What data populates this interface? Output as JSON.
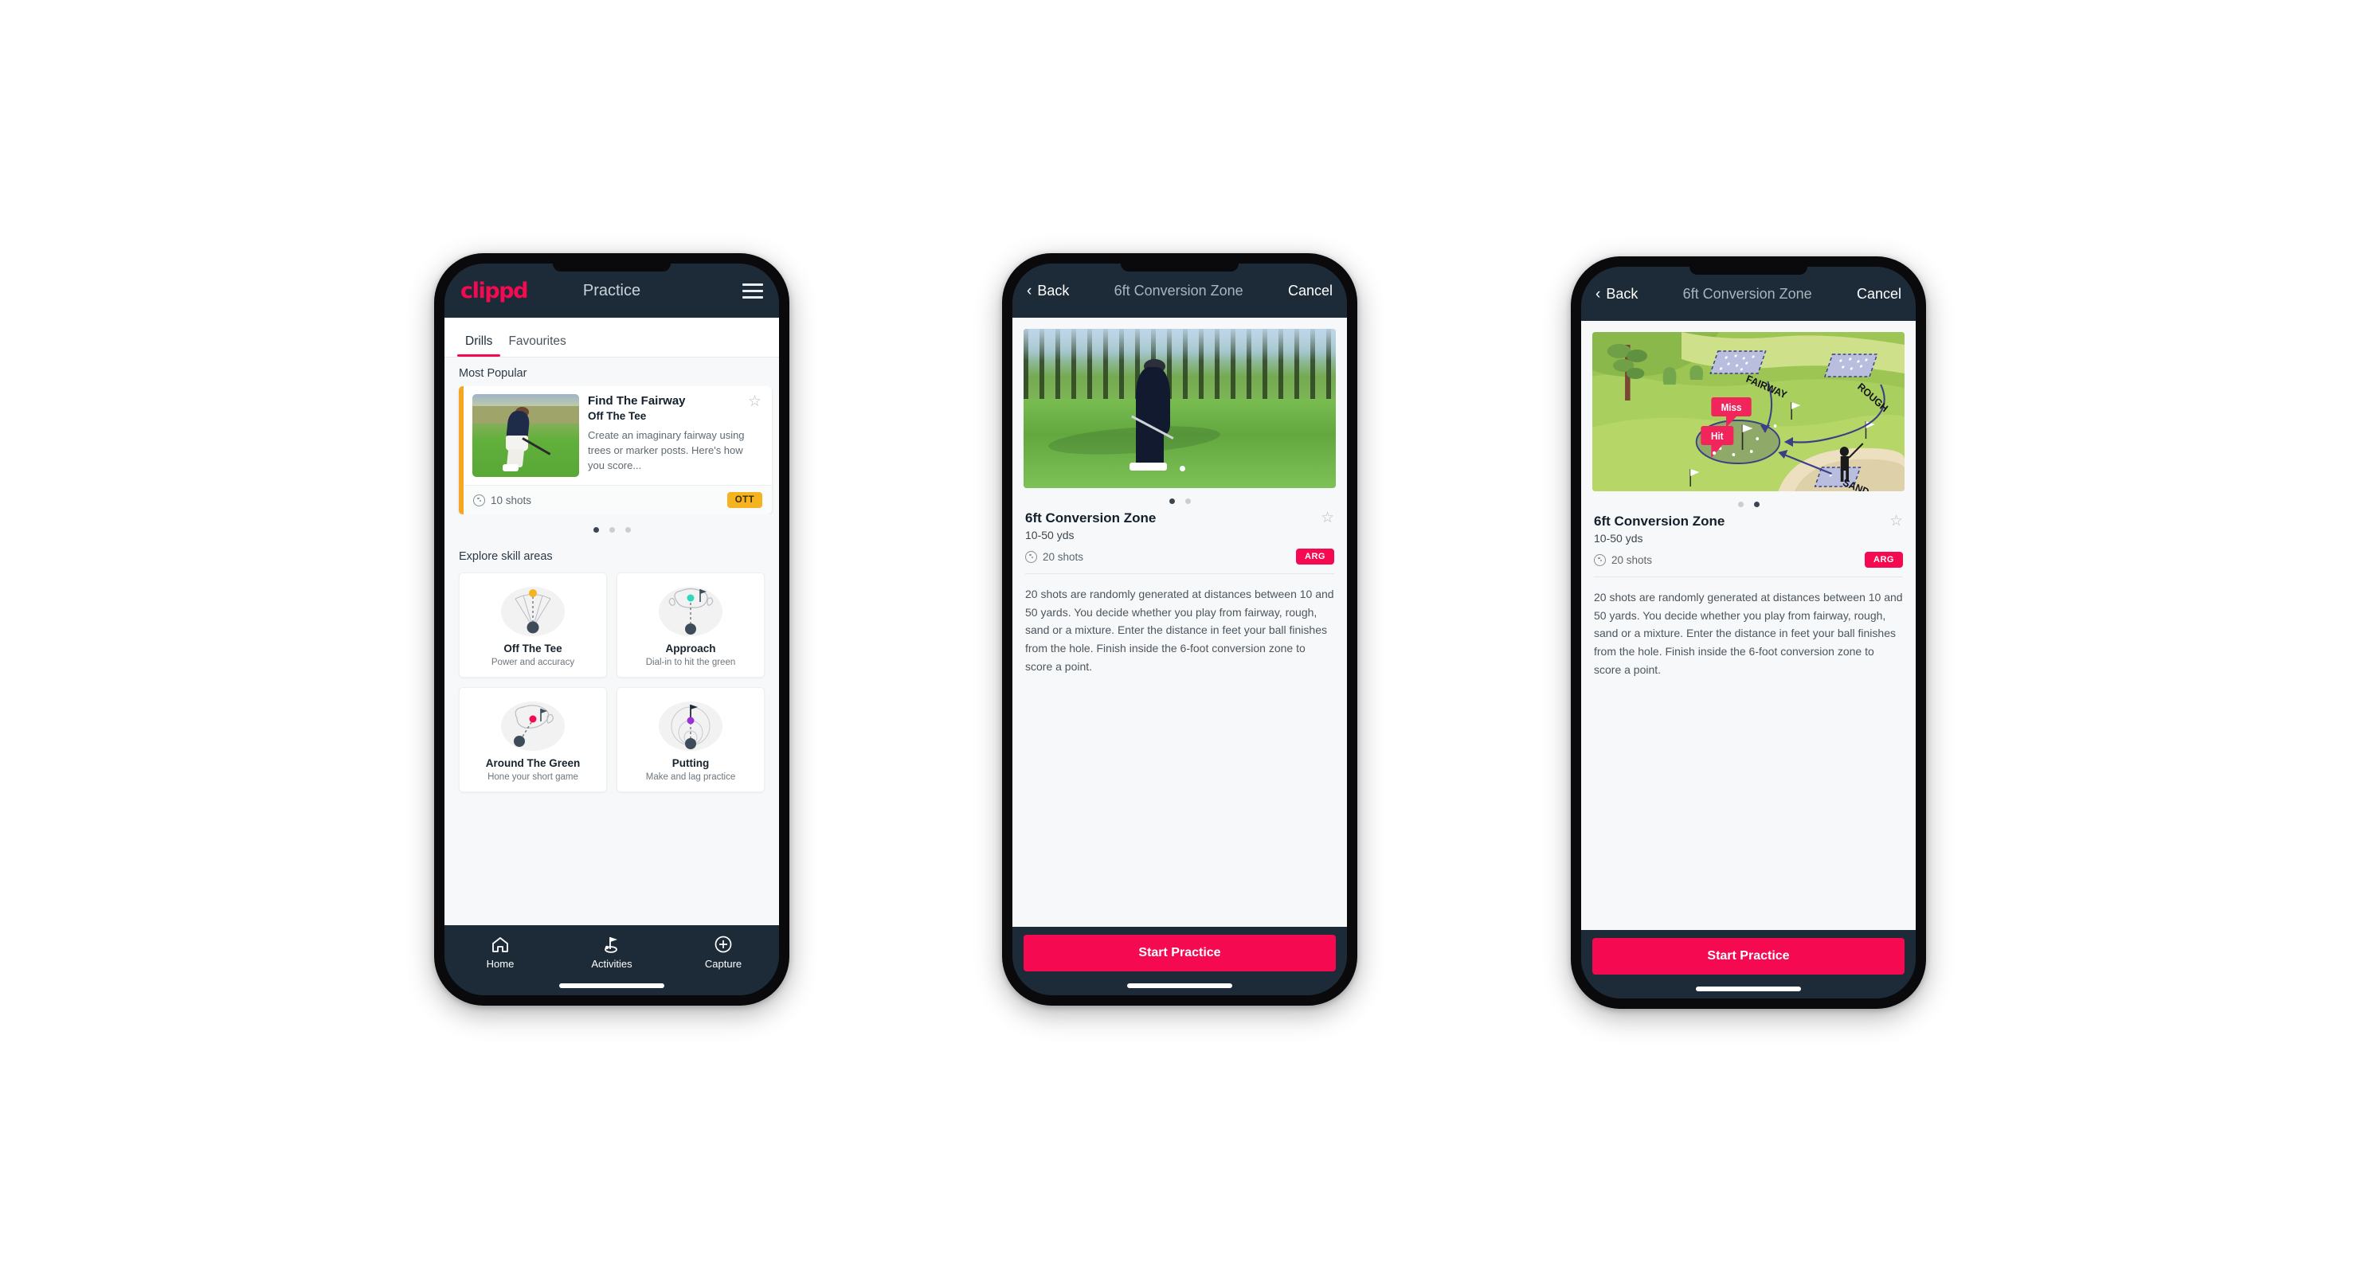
{
  "phone1": {
    "appbar": {
      "brand": "clippd",
      "title": "Practice",
      "menu_icon": "hamburger-icon"
    },
    "tabs": [
      {
        "label": "Drills",
        "active": true
      },
      {
        "label": "Favourites",
        "active": false
      }
    ],
    "most_popular": {
      "section_label": "Most Popular",
      "card": {
        "title": "Find The Fairway",
        "subtitle": "Off The Tee",
        "description": "Create an imaginary fairway using trees or marker posts. Here's how you score...",
        "shots": "10 shots",
        "badge": "OTT",
        "badge_color": "#f5b320",
        "accent_color": "#f5a623",
        "star_icon": "star-outline-icon",
        "shots_icon": "shots-icon"
      },
      "peek_accent_color": "#2fd6c0",
      "dots": [
        true,
        false,
        false
      ]
    },
    "skill_areas": {
      "section_label": "Explore skill areas",
      "items": [
        {
          "name": "Off The Tee",
          "desc": "Power and accuracy",
          "icon": "tee-dispersion-icon",
          "accent": "#f5b320"
        },
        {
          "name": "Approach",
          "desc": "Dial-in to hit the green",
          "icon": "approach-green-icon",
          "accent": "#2fd6c0"
        },
        {
          "name": "Around The Green",
          "desc": "Hone your short game",
          "icon": "around-green-icon",
          "accent": "#f50a52"
        },
        {
          "name": "Putting",
          "desc": "Make and lag practice",
          "icon": "putting-rings-icon",
          "accent": "#9b30d9"
        }
      ]
    },
    "bottom_nav": [
      {
        "label": "Home",
        "icon": "home-icon",
        "active": false
      },
      {
        "label": "Activities",
        "icon": "golf-flag-icon",
        "active": true
      },
      {
        "label": "Capture",
        "icon": "plus-circle-icon",
        "active": false
      }
    ]
  },
  "phone2": {
    "navbar": {
      "back": "Back",
      "title": "6ft Conversion Zone",
      "cancel": "Cancel",
      "back_icon": "chevron-left-icon"
    },
    "hero": {
      "type": "photo",
      "alt": "golfer-chipping-photo"
    },
    "dots": [
      true,
      false
    ],
    "detail": {
      "title": "6ft Conversion Zone",
      "subtitle": "10-50 yds",
      "shots": "20 shots",
      "badge": "ARG",
      "badge_color": "#f50a52",
      "star_icon": "star-outline-icon",
      "shots_icon": "shots-icon",
      "description": "20 shots are randomly generated at distances between 10 and 50 yards. You decide whether you play from fairway, rough, sand or a mixture. Enter the distance in feet your ball finishes from the hole. Finish inside the 6-foot conversion zone to score a point."
    },
    "cta": "Start Practice"
  },
  "phone3": {
    "navbar": {
      "back": "Back",
      "title": "6ft Conversion Zone",
      "cancel": "Cancel",
      "back_icon": "chevron-left-icon"
    },
    "hero": {
      "type": "illustration",
      "alt": "golf-course-diagram",
      "labels": {
        "fairway": "FAIRWAY",
        "rough": "ROUGH",
        "sand": "SAND",
        "miss": "Miss",
        "hit": "Hit"
      }
    },
    "dots": [
      false,
      true
    ],
    "detail": {
      "title": "6ft Conversion Zone",
      "subtitle": "10-50 yds",
      "shots": "20 shots",
      "badge": "ARG",
      "badge_color": "#f50a52",
      "star_icon": "star-outline-icon",
      "shots_icon": "shots-icon",
      "description": "20 shots are randomly generated at distances between 10 and 50 yards. You decide whether you play from fairway, rough, sand or a mixture. Enter the distance in feet your ball finishes from the hole. Finish inside the 6-foot conversion zone to score a point."
    },
    "cta": "Start Practice"
  }
}
